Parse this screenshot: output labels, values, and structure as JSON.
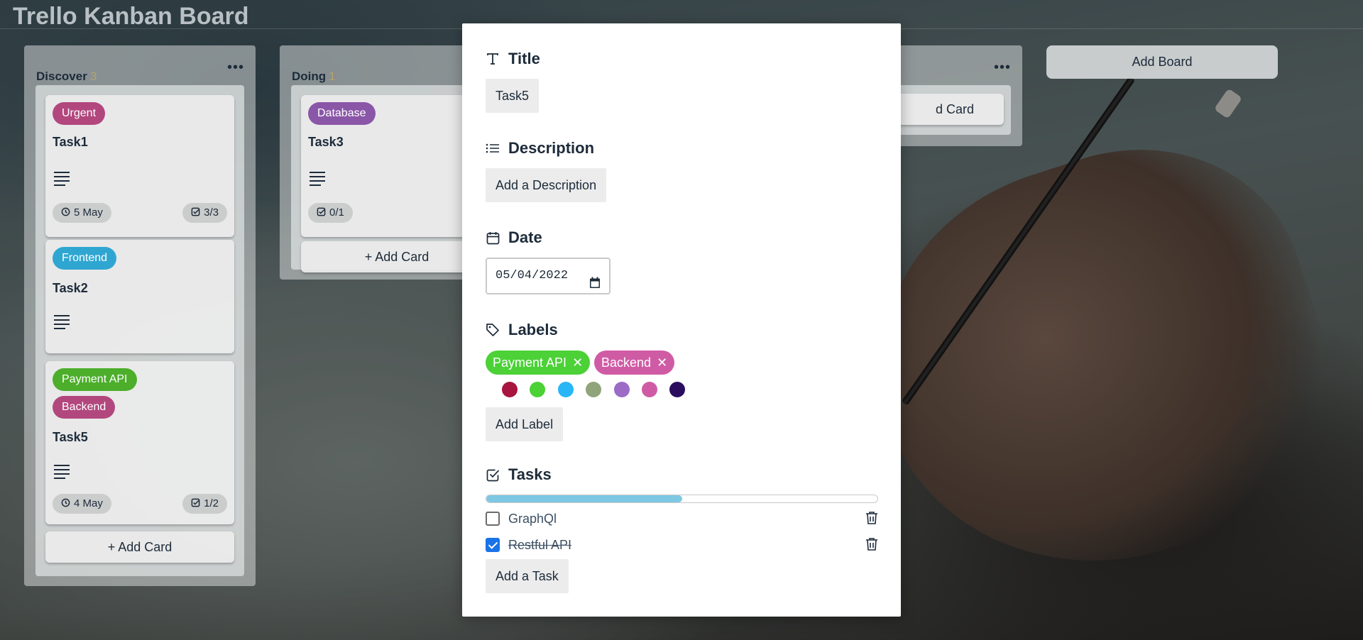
{
  "board": {
    "title": "Trello Kanban Board",
    "add_board_label": "Add Board"
  },
  "columns": [
    {
      "name": "Discover",
      "count": "3",
      "cards": [
        {
          "labels": [
            {
              "text": "Urgent",
              "color": "#b2477e"
            }
          ],
          "title": "Task1",
          "date": "5 May",
          "tasks": "3/3"
        },
        {
          "labels": [
            {
              "text": "Frontend",
              "color": "#2fa6d2"
            }
          ],
          "title": "Task2"
        },
        {
          "labels": [
            {
              "text": "Payment API",
              "color": "#4cae2b"
            },
            {
              "text": "Backend",
              "color": "#b2477e"
            }
          ],
          "title": "Task5",
          "date": "4 May",
          "tasks": "1/2"
        }
      ],
      "add_card_label": "+ Add Card"
    },
    {
      "name": "Doing",
      "count": "1",
      "cards": [
        {
          "labels": [
            {
              "text": "Database",
              "color": "#8a56a8"
            }
          ],
          "title": "Task3",
          "tasks": "0/1"
        }
      ],
      "add_card_label": "+ Add Card"
    },
    {
      "name": "",
      "add_card_label": "d Card"
    }
  ],
  "modal": {
    "title_heading": "Title",
    "title_value": "Task5",
    "description_heading": "Description",
    "description_button": "Add a Description",
    "date_heading": "Date",
    "date_value": "05/04/2022",
    "labels_heading": "Labels",
    "labels": [
      {
        "text": "Payment API",
        "color": "#4cd137"
      },
      {
        "text": "Backend",
        "color": "#d05ba5"
      }
    ],
    "label_colors": [
      "#a8153f",
      "#4cd137",
      "#29b6f6",
      "#8fa47a",
      "#9b6bc6",
      "#d05ba5",
      "#2a0d5e"
    ],
    "add_label_button": "Add Label",
    "tasks_heading": "Tasks",
    "tasks_progress": 0.5,
    "tasks": [
      {
        "text": "GraphQl",
        "done": false
      },
      {
        "text": "Restful API",
        "done": true
      }
    ],
    "add_task_button": "Add a Task"
  },
  "icons": {
    "title": "text-t-icon",
    "description": "list-icon",
    "date": "calendar-icon",
    "labels": "tag-icon",
    "tasks": "checkbox-icon",
    "clock": "clock-icon",
    "check_square": "check-square-icon",
    "trash": "trash-icon",
    "more": "more-dots-icon"
  }
}
